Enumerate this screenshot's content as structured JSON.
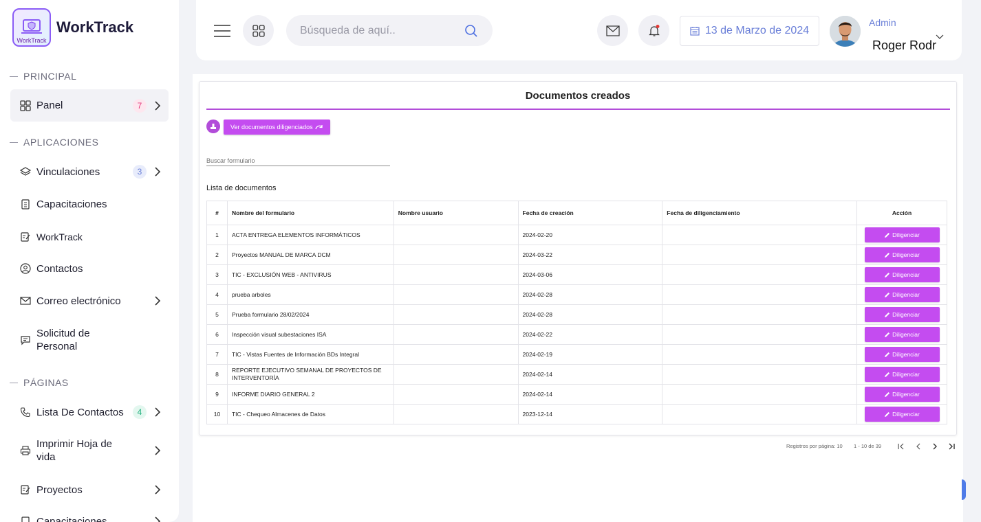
{
  "app": {
    "name": "WorkTrack",
    "logo_small": "WorkTrack"
  },
  "sidebar": {
    "sections": [
      {
        "label": "PRINCIPAL"
      },
      {
        "label": "APLICACIONES"
      },
      {
        "label": "PÁGINAS"
      }
    ],
    "items": [
      {
        "label": "Panel",
        "icon": "grid-icon",
        "badge": "7",
        "badge_color": "#e5397a"
      },
      {
        "label": "Vinculaciones",
        "icon": "layers-icon",
        "badge": "3",
        "badge_color": "#6a7fd8"
      },
      {
        "label": "Capacitaciones",
        "icon": "clipboard-icon"
      },
      {
        "label": "WorkTrack",
        "icon": "edit-note-icon"
      },
      {
        "label": "Contactos",
        "icon": "user-circle-icon"
      },
      {
        "label": "Correo electrónico",
        "icon": "mail-icon"
      },
      {
        "label": "Solicitud de Personal",
        "icon": "chat-icon"
      },
      {
        "label": "Lista De Contactos",
        "icon": "phone-icon",
        "badge": "4",
        "badge_color": "#22b07d"
      },
      {
        "label": "Imprimir Hoja de vida",
        "icon": "printer-icon"
      },
      {
        "label": "Proyectos",
        "icon": "edit-note-icon"
      },
      {
        "label": "Capacitaciones",
        "icon": "clipboard-icon"
      }
    ]
  },
  "header": {
    "search_placeholder": "Búsqueda de aquí..",
    "date": "13 de Marzo de 2024",
    "role": "Admin",
    "user": "Roger Rodr"
  },
  "main": {
    "title": "Documentos creados",
    "view_button": "Ver documentos diligenciados",
    "search_placeholder": "Buscar formulario",
    "list_title": "Lista de documentos",
    "columns": [
      "#",
      "Nombre del formulario",
      "Nombre usuario",
      "Fecha de creación",
      "Fecha de diligenciamiento",
      "Acción"
    ],
    "action_label": "Diligenciar",
    "rows": [
      {
        "n": "1",
        "form": "ACTA ENTREGA ELEMENTOS INFORMÁTICOS",
        "user": "",
        "created": "2024-02-20",
        "filled": ""
      },
      {
        "n": "2",
        "form": "Proyectos MANUAL DE MARCA DCM",
        "user": "",
        "created": "2024-03-22",
        "filled": ""
      },
      {
        "n": "3",
        "form": "TIC - EXCLUSIÓN WEB - ANTIVIRUS",
        "user": "",
        "created": "2024-03-06",
        "filled": ""
      },
      {
        "n": "4",
        "form": "prueba arboles",
        "user": "",
        "created": "2024-02-28",
        "filled": ""
      },
      {
        "n": "5",
        "form": "Prueba formulario 28/02/2024",
        "user": "",
        "created": "2024-02-28",
        "filled": ""
      },
      {
        "n": "6",
        "form": "Inspección visual subestaciones ISA",
        "user": "",
        "created": "2024-02-22",
        "filled": ""
      },
      {
        "n": "7",
        "form": "TIC - Vistas Fuentes de Información BDs Integral",
        "user": "",
        "created": "2024-02-19",
        "filled": ""
      },
      {
        "n": "8",
        "form": "REPORTE EJECUTIVO SEMANAL DE PROYECTOS DE INTERVENTORÍA",
        "user": "",
        "created": "2024-02-14",
        "filled": ""
      },
      {
        "n": "9",
        "form": "INFORME DIARIO GENERAL 2",
        "user": "",
        "created": "2024-02-14",
        "filled": ""
      },
      {
        "n": "10",
        "form": "TIC - Chequeo Almacenes de Datos",
        "user": "",
        "created": "2023-12-14",
        "filled": ""
      }
    ],
    "pagination": {
      "per_page_label": "Registros por página: 10",
      "range": "1 - 10 de 39"
    }
  },
  "colors": {
    "accent": "#c44cf0",
    "accent_line": "#b24dd9",
    "date_text": "#6a7fd8"
  }
}
